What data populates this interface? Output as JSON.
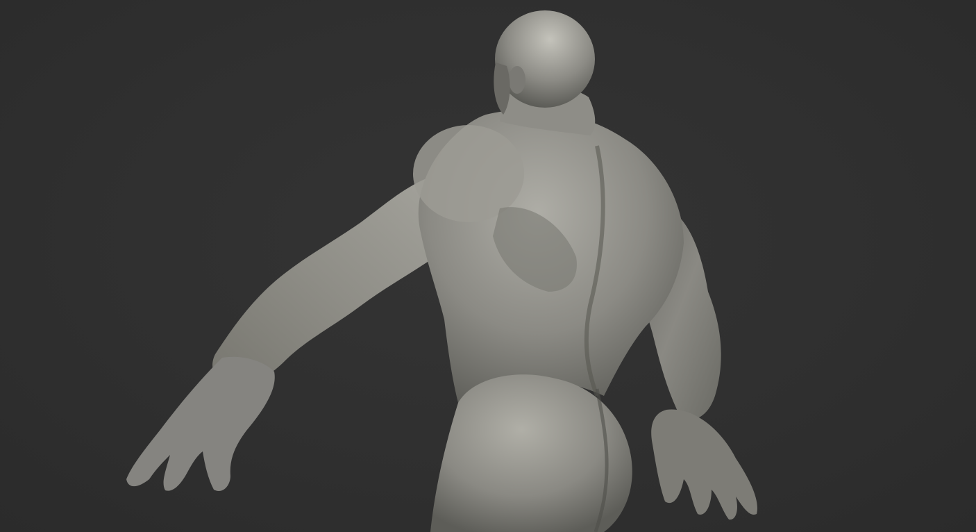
{
  "viewport": {
    "background_color": "#303030",
    "model_material_color": "#8a8a84",
    "model_highlight_color": "#c9c8c0",
    "model_shadow_color": "#4a4a46"
  },
  "model": {
    "subject": "sculpted-muscular-male-figure-back-view"
  }
}
